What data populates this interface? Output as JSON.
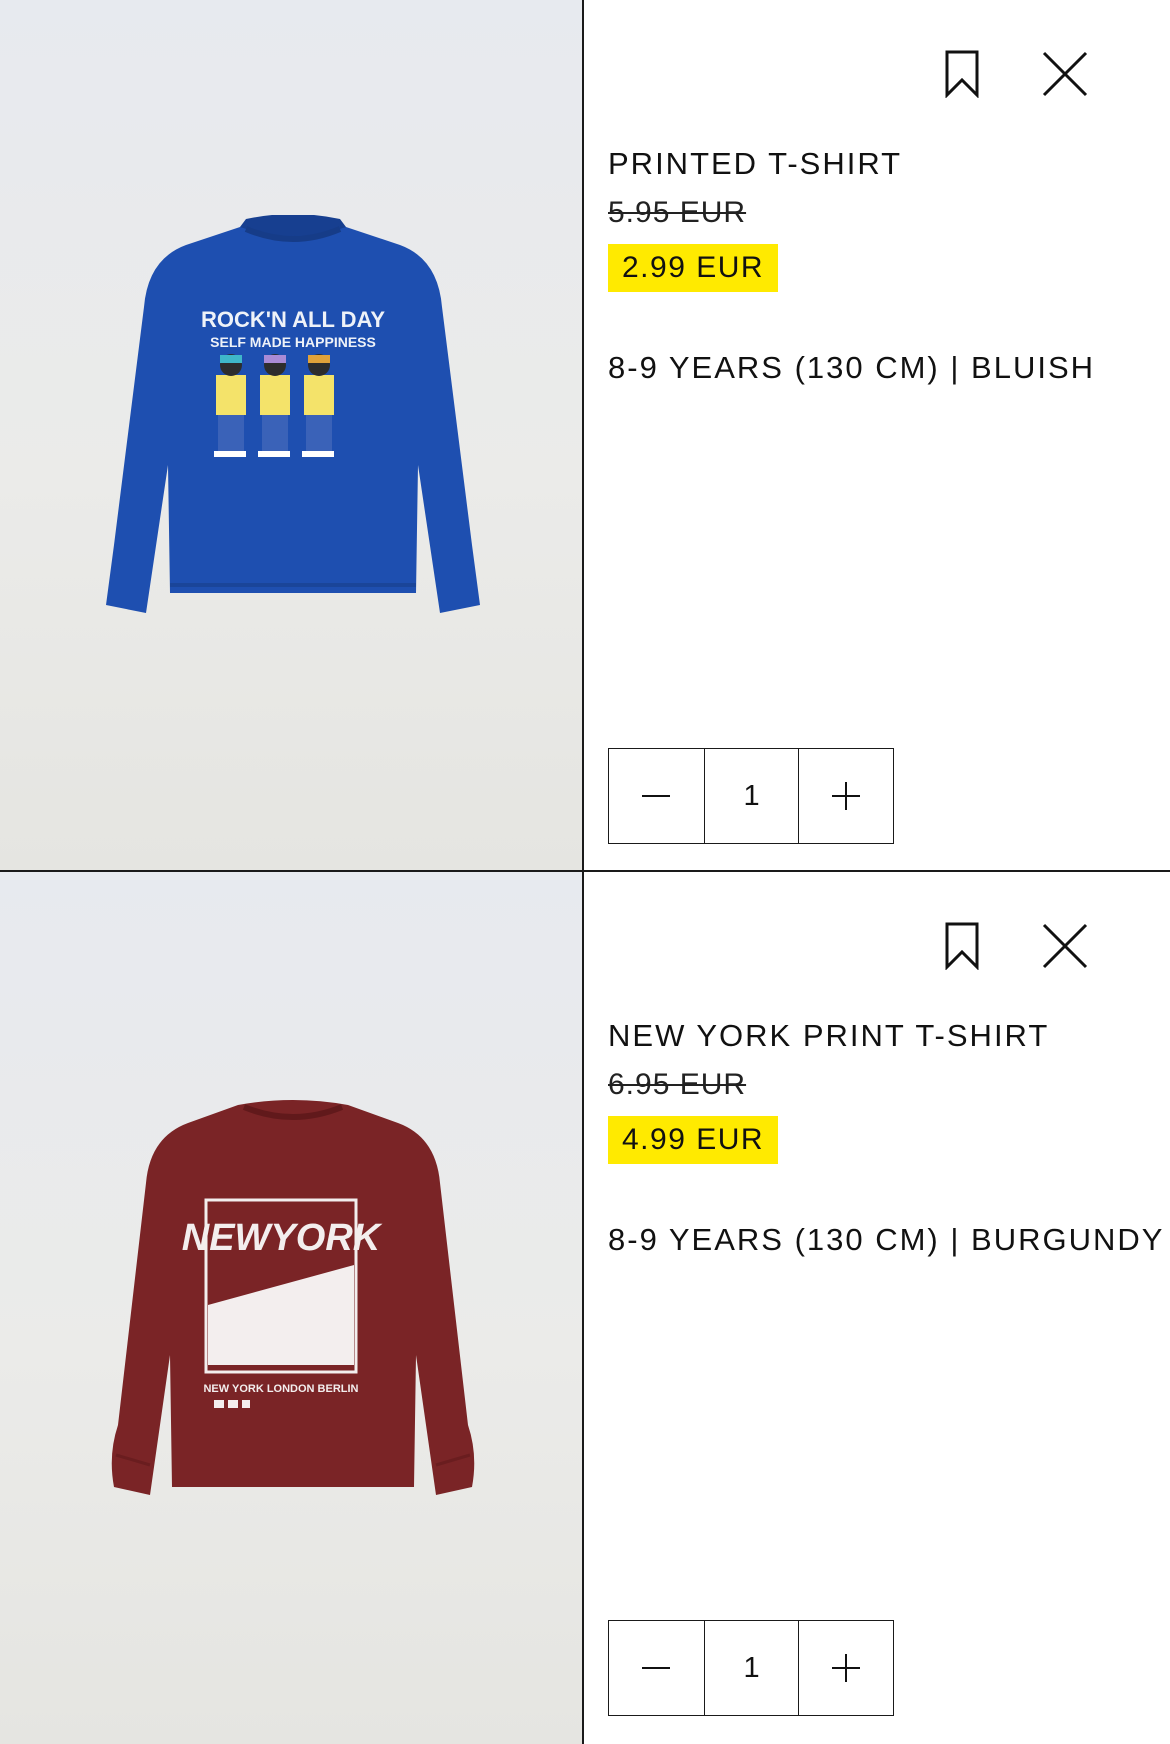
{
  "items": [
    {
      "name": "PRINTED T-SHIRT",
      "old_price": "5.95 EUR",
      "sale_price": "2.99 EUR",
      "variant": "8-9 YEARS (130 CM) | BLUISH",
      "quantity": "1",
      "shirt_color": "#1e4fb0",
      "print_line1": "ROCK'N ALL DAY",
      "print_line2": "SELF MADE HAPPINESS"
    },
    {
      "name": "NEW YORK PRINT T-SHIRT",
      "old_price": "6.95 EUR",
      "sale_price": "4.99 EUR",
      "variant": "8-9 YEARS (130 CM) | BURGUNDY",
      "quantity": "1",
      "shirt_color": "#7a2426",
      "print_line1": "NEWYORK",
      "print_line2": "NEW YORK LONDON BERLIN"
    }
  ],
  "icons": {
    "save": "bookmark-icon",
    "remove": "close-icon",
    "decrease": "minus-icon",
    "increase": "plus-icon"
  },
  "colors": {
    "sale_highlight": "#ffea00",
    "border": "#1a1a1a"
  }
}
